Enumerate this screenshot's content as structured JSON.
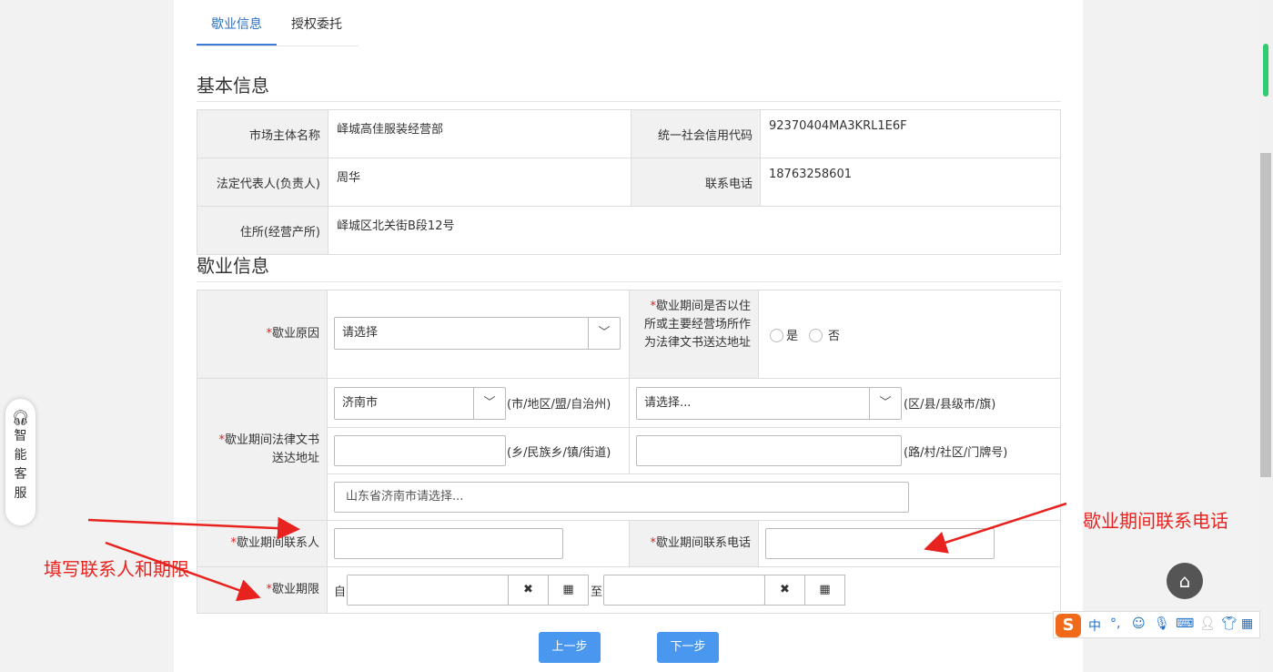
{
  "tabs": [
    "歇业信息",
    "授权委托"
  ],
  "basic": {
    "title": "基本信息",
    "rows": [
      {
        "l1": "市场主体名称",
        "v1": "峄城高佳服装经营部",
        "l2": "统一社会信用代码",
        "v2": "92370404MA3KRL1E6F"
      },
      {
        "l1": "法定代表人(负责人)",
        "v1": "周华",
        "l2": "联系电话",
        "v2": "18763258601"
      },
      {
        "l1": "住所(经营产所)",
        "v1": "峄城区北关街B段12号"
      }
    ]
  },
  "form": {
    "title": "歇业信息",
    "required_mark": "*",
    "reason_label": "歇业原因",
    "reason_select": "请选择",
    "service_addr_q": "歇业期间是否以住所或主要经营场所作为法律文书送达地址",
    "radio_yes": "是",
    "radio_no": "否",
    "address_label": "歇业期间法律文书送达地址",
    "city_select": "济南市",
    "city_suffix": "(市/地区/盟/自治州)",
    "district_select": "请选择...",
    "district_suffix": "(区/县/县级市/旗)",
    "town_suffix": "(乡/民族乡/镇/街道)",
    "road_suffix": "(路/村/社区/门牌号)",
    "full_address_placeholder": "山东省济南市请选择...",
    "contact_label": "歇业期间联系人",
    "contact_phone_label": "歇业期间联系电话",
    "period_label": "歇业期限",
    "from": "自",
    "to": "至",
    "clear_glyph": "✖",
    "calendar_glyph": "▦"
  },
  "buttons": {
    "prev": "上一步",
    "next": "下一步"
  },
  "annotations": {
    "phone": "歇业期间联系电话",
    "contact": "填写联系人和期限"
  },
  "assistant": [
    "智",
    "能",
    "客",
    "服"
  ],
  "ime": {
    "lang": "中",
    "punct": "°,"
  },
  "colors": {
    "accent": "#3a7bd5",
    "primary_button": "#4a97ef",
    "annotation": "#e8231f",
    "required": "#e02020"
  }
}
